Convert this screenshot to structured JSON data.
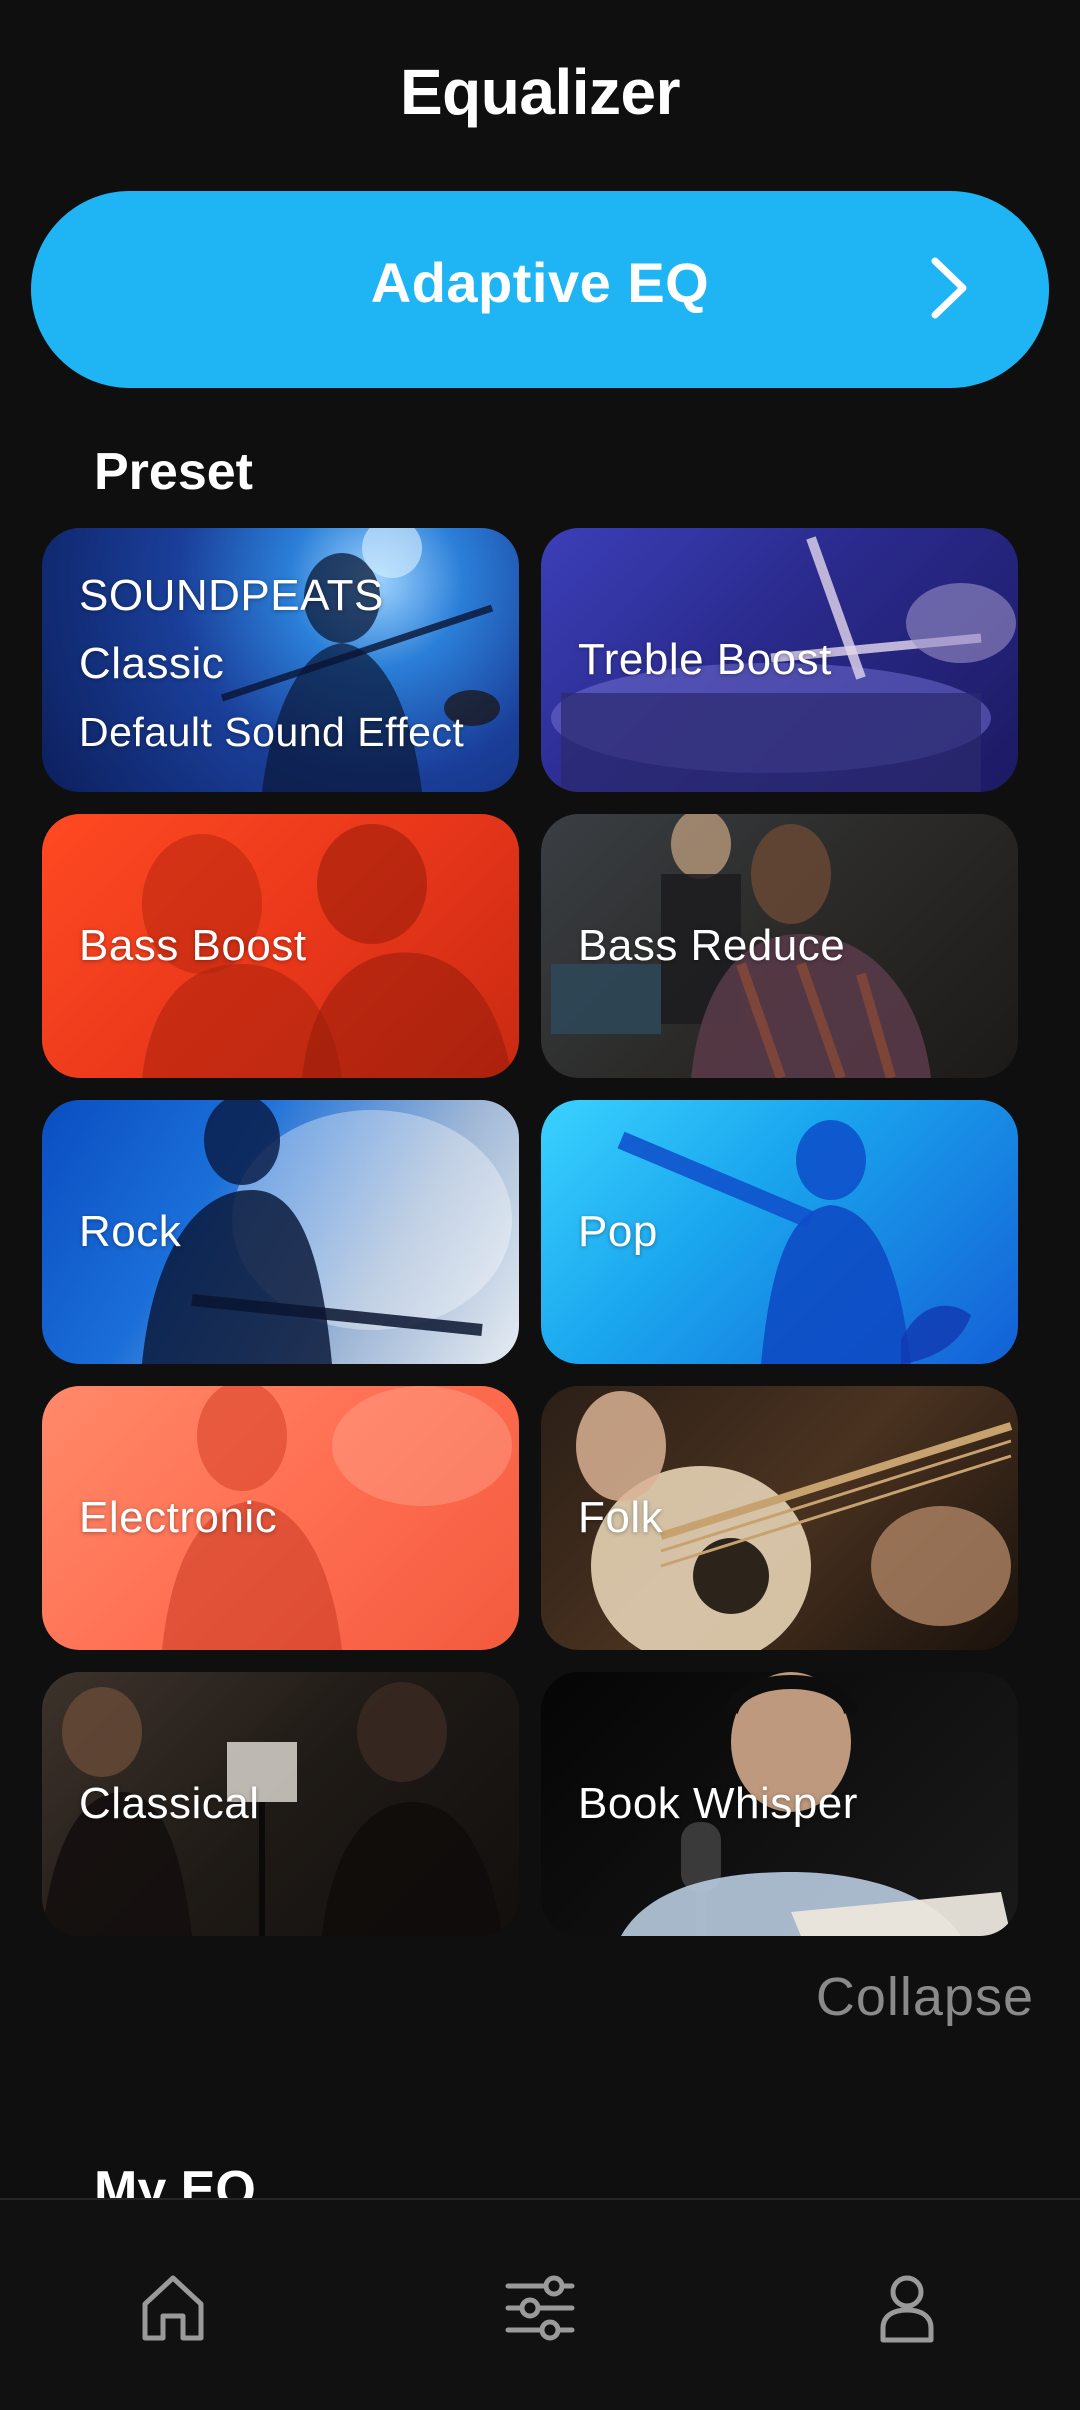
{
  "header": {
    "title": "Equalizer"
  },
  "adaptive_eq": {
    "label": "Adaptive EQ",
    "icon": "chevron-right-icon"
  },
  "preset": {
    "title": "Preset",
    "cards": [
      {
        "lines": [
          "SOUNDPEATS",
          "Classic",
          "Default Sound Effect"
        ]
      },
      {
        "label": "Treble Boost"
      },
      {
        "label": "Bass Boost"
      },
      {
        "label": "Bass Reduce"
      },
      {
        "label": "Rock"
      },
      {
        "label": "Pop"
      },
      {
        "label": "Electronic"
      },
      {
        "label": "Folk"
      },
      {
        "label": "Classical"
      },
      {
        "label": "Book Whisper"
      }
    ],
    "collapse_label": "Collapse"
  },
  "my_eq": {
    "title": "My EQ"
  },
  "bottom_nav": {
    "items": [
      {
        "icon": "home-icon"
      },
      {
        "icon": "equalizer-sliders-icon"
      },
      {
        "icon": "profile-icon"
      }
    ]
  }
}
